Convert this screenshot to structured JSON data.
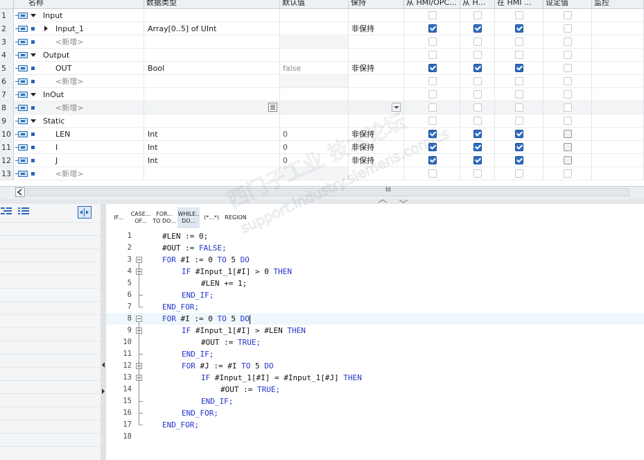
{
  "table": {
    "headers": [
      {
        "key": "name",
        "label": "名称"
      },
      {
        "key": "dtype",
        "label": "数据类型"
      },
      {
        "key": "default",
        "label": "默认值"
      },
      {
        "key": "retain",
        "label": "保持"
      },
      {
        "key": "hmi_acc",
        "label": "从 HMI/OPC..."
      },
      {
        "key": "hmi_vis",
        "label": "从 H..."
      },
      {
        "key": "hmi_eng",
        "label": "在 HMI ..."
      },
      {
        "key": "setpoint",
        "label": "设定值"
      },
      {
        "key": "monitor",
        "label": "监控"
      }
    ],
    "rows": [
      {
        "num": "1",
        "kind": "section",
        "name": "Input",
        "dtype": "",
        "default": "",
        "retain": "",
        "c1": false,
        "c2": false,
        "c3": false,
        "sp": false
      },
      {
        "num": "2",
        "kind": "var",
        "expander": true,
        "name": "Input_1",
        "dtype": "Array[0..5] of UInt",
        "default": "",
        "retain": "非保持",
        "c1": true,
        "c2": true,
        "c3": true,
        "sp": false
      },
      {
        "num": "3",
        "kind": "new",
        "name": "<新增>",
        "dtype": "",
        "default": "",
        "retain": "",
        "c1": false,
        "c2": false,
        "c3": false,
        "sp": false
      },
      {
        "num": "4",
        "kind": "section",
        "name": "Output",
        "dtype": "",
        "default": "",
        "retain": "",
        "c1": false,
        "c2": false,
        "c3": false,
        "sp": false
      },
      {
        "num": "5",
        "kind": "var",
        "name": "OUT",
        "dtype": "Bool",
        "default": "false",
        "retain": "非保持",
        "c1": true,
        "c2": true,
        "c3": true,
        "sp": false
      },
      {
        "num": "6",
        "kind": "new",
        "name": "<新增>",
        "dtype": "",
        "default": "",
        "retain": "",
        "c1": false,
        "c2": false,
        "c3": false,
        "sp": false
      },
      {
        "num": "7",
        "kind": "section",
        "name": "InOut",
        "dtype": "",
        "default": "",
        "retain": "",
        "c1": false,
        "c2": false,
        "c3": false,
        "sp": false
      },
      {
        "num": "8",
        "kind": "new",
        "editing": true,
        "name": "<新增>",
        "dtype": "",
        "default": "",
        "retain": "",
        "c1": false,
        "c2": false,
        "c3": false,
        "sp": false
      },
      {
        "num": "9",
        "kind": "section",
        "name": "Static",
        "dtype": "",
        "default": "",
        "retain": "",
        "c1": false,
        "c2": false,
        "c3": false,
        "sp": false
      },
      {
        "num": "10",
        "kind": "var",
        "name": "LEN",
        "dtype": "Int",
        "default": "0",
        "retain": "非保持",
        "c1": true,
        "c2": true,
        "c3": true,
        "sp": true
      },
      {
        "num": "11",
        "kind": "var",
        "name": "I",
        "dtype": "Int",
        "default": "0",
        "retain": "非保持",
        "c1": true,
        "c2": true,
        "c3": true,
        "sp": true
      },
      {
        "num": "12",
        "kind": "var",
        "name": "J",
        "dtype": "Int",
        "default": "0",
        "retain": "非保持",
        "c1": true,
        "c2": true,
        "c3": true,
        "sp": true
      },
      {
        "num": "13",
        "kind": "new",
        "name": "<新增>",
        "dtype": "",
        "default": "",
        "retain": "",
        "c1": false,
        "c2": false,
        "c3": false,
        "sp": false
      }
    ]
  },
  "scrollbar": {
    "thumb_label": "III"
  },
  "toolbar": {
    "buttons": [
      {
        "id": "if",
        "label": "IF..."
      },
      {
        "id": "case",
        "label": "CASE...\nOF..."
      },
      {
        "id": "for",
        "label": "FOR...\nTO DO..."
      },
      {
        "id": "while",
        "label": "WHILE..\nDO...",
        "selected": true
      },
      {
        "id": "comment",
        "label": "(*...*)"
      },
      {
        "id": "region",
        "label": "REGION"
      }
    ]
  },
  "code": {
    "cursor_line": 8,
    "lines": [
      {
        "n": "1",
        "indent": 0,
        "text": "#LEN := 0;"
      },
      {
        "n": "2",
        "indent": 0,
        "text": "#OUT := FALSE;"
      },
      {
        "n": "3",
        "indent": 0,
        "text": "FOR #I := 0 TO 5 DO",
        "fold": true
      },
      {
        "n": "4",
        "indent": 1,
        "text": "IF #Input_1[#I] > 0 THEN",
        "fold": true
      },
      {
        "n": "5",
        "indent": 2,
        "text": "#LEN += 1;"
      },
      {
        "n": "6",
        "indent": 1,
        "text": "END_IF;"
      },
      {
        "n": "7",
        "indent": 0,
        "text": "END_FOR;"
      },
      {
        "n": "8",
        "indent": 0,
        "text": "FOR #I := 0 TO 5 DO",
        "fold": true
      },
      {
        "n": "9",
        "indent": 1,
        "text": "IF #Input_1[#I] > #LEN THEN",
        "fold": true
      },
      {
        "n": "10",
        "indent": 2,
        "text": "#OUT := TRUE;"
      },
      {
        "n": "11",
        "indent": 1,
        "text": "END_IF;"
      },
      {
        "n": "12",
        "indent": 1,
        "text": "FOR #J := #I TO 5 DO",
        "fold": true
      },
      {
        "n": "13",
        "indent": 2,
        "text": "IF #Input_1[#I] = #Input_1[#J] THEN",
        "fold": true
      },
      {
        "n": "14",
        "indent": 3,
        "text": "#OUT := TRUE;"
      },
      {
        "n": "15",
        "indent": 2,
        "text": "END_IF;"
      },
      {
        "n": "16",
        "indent": 1,
        "text": "END_FOR;"
      },
      {
        "n": "17",
        "indent": 0,
        "text": "END_FOR;"
      },
      {
        "n": "18",
        "indent": 0,
        "text": ""
      }
    ],
    "keywords": [
      "FOR",
      "TO",
      "DO",
      "IF",
      "THEN",
      "END_IF",
      "END_FOR",
      "FALSE",
      "TRUE"
    ]
  },
  "watermark": {
    "line1": "西门子工业 技术论坛",
    "line2": "support.industry.siemens.com/cs"
  },
  "colors": {
    "keyword": "#2233cc",
    "checkbox_on": "#2e6dc4",
    "accent": "#2a64b8"
  },
  "icons": {
    "row_interface": "interface-param-icon",
    "row_var": "variable-dot-icon",
    "left_toolbar": [
      "indent-list-icon",
      "outdent-list-icon",
      "swap-view-icon"
    ]
  }
}
